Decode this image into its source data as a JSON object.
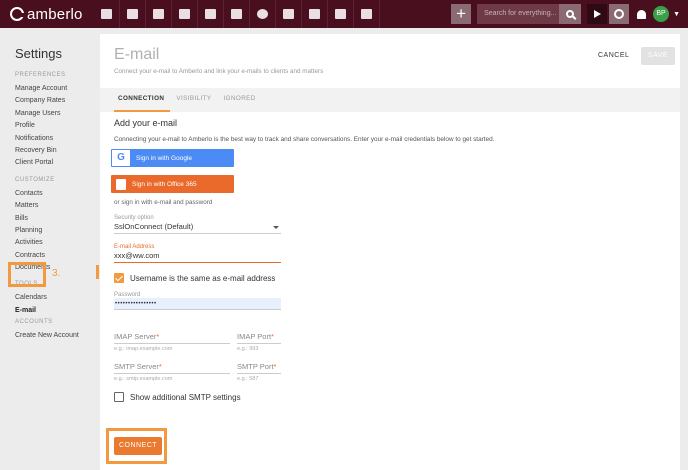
{
  "topbar": {
    "app_name": "amberlo",
    "nav_icons": [
      "dashboard-icon",
      "contacts-icon",
      "matters-icon",
      "bills-icon",
      "bank-icon",
      "calendar-icon",
      "time-icon",
      "folder-icon",
      "documents-icon",
      "mail-icon",
      "reports-icon"
    ],
    "search_placeholder": "Search for everything...",
    "avatar_initials": "BP",
    "brand_color": "#4a0f1f"
  },
  "sidebar": {
    "title": "Settings",
    "sections": [
      {
        "header": "PREFERENCES",
        "items": [
          "Manage Account",
          "Company Rates",
          "Manage Users",
          "Profile",
          "Notifications",
          "Recovery Bin",
          "Client Portal"
        ]
      },
      {
        "header": "CUSTOMIZE",
        "items": [
          "Contacts",
          "Matters",
          "Bills",
          "Planning",
          "Activities",
          "Contracts",
          "Documents"
        ]
      },
      {
        "header": "TOOLS",
        "items": [
          "Calendars",
          "E-mail"
        ]
      },
      {
        "header": "ACCOUNTS",
        "items": [
          "Create New Account"
        ]
      }
    ],
    "active_item": "E-mail",
    "step_label": "3.",
    "highlight_color": "#f29a40"
  },
  "main": {
    "title": "E-mail",
    "subtitle": "Connect your e-mail to Amberlo and link your e-mails to clients and matters",
    "cancel_label": "CANCEL",
    "save_label": "SAVE",
    "tabs": [
      {
        "label": "CONNECTION",
        "active": true
      },
      {
        "label": "VISIBILITY",
        "active": false
      },
      {
        "label": "IGNORED",
        "active": false
      }
    ],
    "section_title": "Add your e-mail",
    "intro": "Connecting your e-mail to Amberlo is the best way to track and share conversations. Enter your e-mail credentials below to get started.",
    "google_btn": "Sign in with Google",
    "office_btn": "Sign in with Office 365",
    "or_text": "or sign in with e-mail and password",
    "security_label": "Security option",
    "security_value": "SslOnConnect (Default)",
    "email_label": "E-mail Address",
    "email_value": "xxx@ww.com",
    "same_username_label": "Username is the same as e-mail address",
    "same_username_checked": true,
    "password_label": "Password",
    "password_value": "••••••••••••••••",
    "imap_server_label": "IMAP Server",
    "imap_server_hint": "e.g.: imap.example.com",
    "imap_port_label": "IMAP Port",
    "imap_port_hint": "e.g.: 993",
    "smtp_server_label": "SMTP Server",
    "smtp_server_hint": "e.g.: smtp.example.com",
    "smtp_port_label": "SMTP Port",
    "smtp_port_hint": "e.g.: 587",
    "required_mark": "*",
    "additional_smtp_label": "Show additional SMTP settings",
    "additional_smtp_checked": false,
    "connect_label": "CONNECT"
  }
}
